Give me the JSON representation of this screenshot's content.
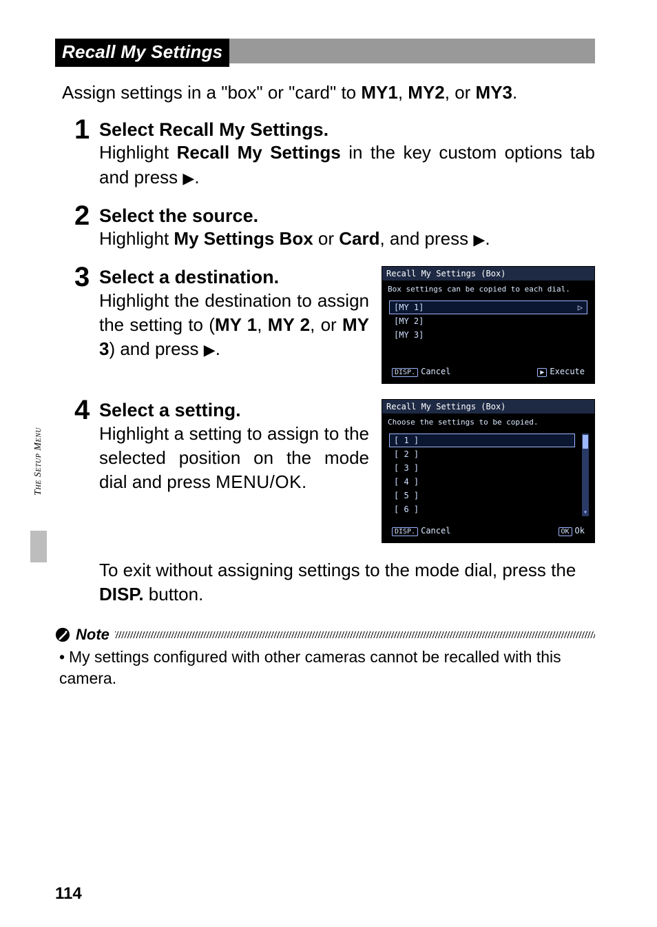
{
  "section_header": "Recall My Settings",
  "intro_pre": "Assign settings in a \"box\" or \"card\" to ",
  "intro_m1": "MY1",
  "intro_m2": "MY2",
  "intro_m3": "MY3",
  "intro_sep": ", ",
  "intro_or": ", or ",
  "intro_end": ".",
  "steps": {
    "s1": {
      "num": "1",
      "title_pre": "Select ",
      "title_bold": "Recall My Settings",
      "title_post": ".",
      "body_a": "Highlight ",
      "body_bold": "Recall My Settings",
      "body_b": " in the key custom options tab and press ",
      "body_c": "."
    },
    "s2": {
      "num": "2",
      "title": "Select the source.",
      "body_a": "Highlight ",
      "body_b1": "My Settings Box",
      "body_or": " or ",
      "body_b2": "Card",
      "body_c": ", and press ",
      "body_d": "."
    },
    "s3": {
      "num": "3",
      "title": "Select a destination.",
      "body_a": "Highlight the destination to assign the setting to (",
      "m1": "MY 1",
      "sep1": ", ",
      "m2": "MY 2",
      "sep2": ", or ",
      "m3": "MY 3",
      "body_b": ") and press ",
      "body_c": "."
    },
    "s4": {
      "num": "4",
      "title": "Select a setting.",
      "body_a": "Highlight a setting to assign to the selected position on the mode dial and press ",
      "menuok": "MENU/OK",
      "body_b": "."
    }
  },
  "after4_a": "To exit without assigning settings to the mode dial, press the ",
  "after4_disp": "DISP.",
  "after4_b": " button.",
  "lcd1": {
    "title": "Recall My Settings (Box)",
    "msg": "Box settings can be copied to each dial.",
    "rows": [
      "[MY 1]",
      "[MY 2]",
      "[MY 3]"
    ],
    "cancel_btn": "DISP.",
    "cancel_txt": "Cancel",
    "exec_btn": "▶",
    "exec_txt": "Execute"
  },
  "lcd2": {
    "title": "Recall My Settings (Box)",
    "msg": "Choose the settings to be copied.",
    "rows": [
      "[ 1 ]",
      "[ 2 ]",
      "[ 3 ]",
      "[ 4 ]",
      "[ 5 ]",
      "[ 6 ]"
    ],
    "cancel_btn": "DISP.",
    "cancel_txt": "Cancel",
    "ok_btn": "OK",
    "ok_txt": "Ok"
  },
  "note_label": "Note",
  "note_body": "My settings configured with other cameras cannot be recalled with this camera.",
  "side_tab": "The Setup Menu",
  "page_number": "114"
}
